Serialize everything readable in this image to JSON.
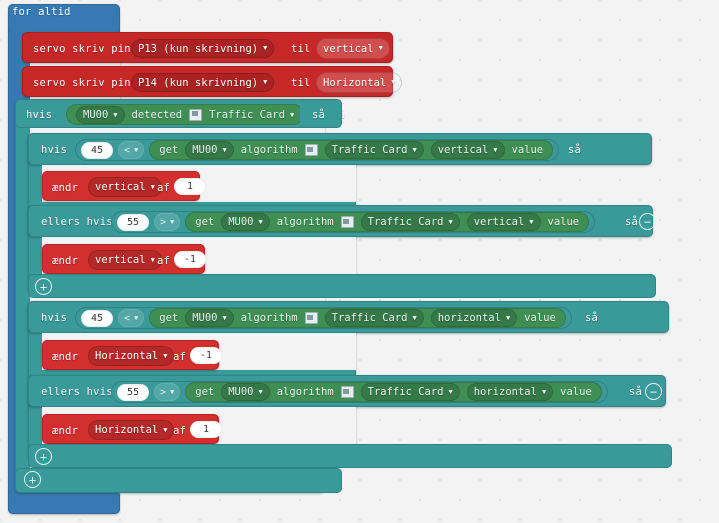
{
  "workspace": {
    "background": "#f3f3f3",
    "grid_dot_color": "#dcdcdc"
  },
  "colors": {
    "loop_blue": "#377ab3",
    "logic_teal": "#3a9a9a",
    "servo_red": "#c62828",
    "variable_red": "#d32f2f",
    "sensor_green": "#3f8f55"
  },
  "blocks": {
    "forever": {
      "label": "for altid"
    },
    "servo1": {
      "action": "servo skriv pin",
      "pin": "P13 (kun skrivning)",
      "to": "til",
      "value": "vertical"
    },
    "servo2": {
      "action": "servo skriv pin",
      "pin": "P14 (kun skrivning)",
      "to": "til",
      "value": "Horizontal"
    },
    "outer_if": {
      "if": "hvis",
      "then": "så",
      "condition": {
        "device": "MU00",
        "verb": "detected",
        "card_icon": "traffic-card-icon",
        "target": "Traffic Card"
      }
    },
    "vertical_if": {
      "if": "hvis",
      "then": "så",
      "number": "45",
      "operator": "<",
      "get": "get",
      "device": "MU00",
      "algorithm": "algorithm",
      "card_icon": "traffic-card-icon",
      "target": "Traffic Card",
      "axis": "vertical",
      "value_word": "value",
      "body": {
        "action": "ændr",
        "variable": "vertical",
        "by": "af",
        "amount": "1"
      }
    },
    "vertical_elseif": {
      "else_if": "ellers hvis",
      "then": "så",
      "number": "55",
      "operator": ">",
      "get": "get",
      "device": "MU00",
      "algorithm": "algorithm",
      "card_icon": "traffic-card-icon",
      "target": "Traffic Card",
      "axis": "vertical",
      "value_word": "value",
      "minus_icon": "minus-circle-icon",
      "body": {
        "action": "ændr",
        "variable": "vertical",
        "by": "af",
        "amount": "-1"
      }
    },
    "vertical_plus": {
      "icon": "plus-circle-icon"
    },
    "horizontal_if": {
      "if": "hvis",
      "then": "så",
      "number": "45",
      "operator": "<",
      "get": "get",
      "device": "MU00",
      "algorithm": "algorithm",
      "card_icon": "traffic-card-icon",
      "target": "Traffic Card",
      "axis": "horizontal",
      "value_word": "value",
      "body": {
        "action": "ændr",
        "variable": "Horizontal",
        "by": "af",
        "amount": "-1"
      }
    },
    "horizontal_elseif": {
      "else_if": "ellers hvis",
      "then": "så",
      "number": "55",
      "operator": ">",
      "get": "get",
      "device": "MU00",
      "algorithm": "algorithm",
      "card_icon": "traffic-card-icon",
      "target": "Traffic Card",
      "axis": "horizontal",
      "value_word": "value",
      "minus_icon": "minus-circle-icon",
      "body": {
        "action": "ændr",
        "variable": "Horizontal",
        "by": "af",
        "amount": "1"
      }
    },
    "horizontal_plus": {
      "icon": "plus-circle-icon"
    },
    "outer_plus": {
      "icon": "plus-circle-icon"
    }
  }
}
